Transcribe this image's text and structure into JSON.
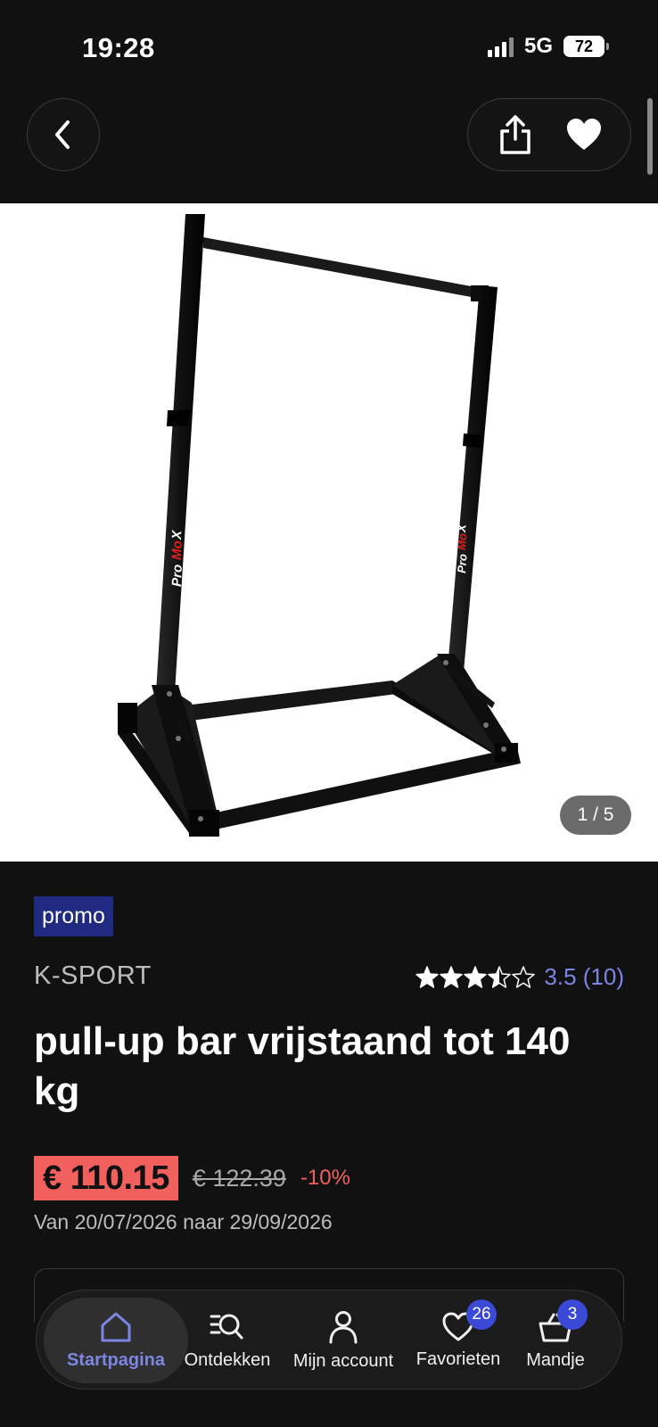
{
  "status_bar": {
    "time": "19:28",
    "network": "5G",
    "battery": "72"
  },
  "nav": {
    "back_icon": "chevron-left-icon",
    "share_icon": "share-icon",
    "favorite_icon": "heart-icon"
  },
  "gallery": {
    "counter": "1 / 5",
    "current": 1,
    "total": 5
  },
  "product": {
    "badge": "promo",
    "brand": "K-SPORT",
    "rating_value": 3.5,
    "rating_text": "3.5 (10)",
    "title": "pull-up bar vrijstaand tot 140 kg",
    "price_current": "€ 110.15",
    "price_old": "€ 122.39",
    "discount": "-10%",
    "validity": "Van 20/07/2026 naar 29/09/2026"
  },
  "tabbar": {
    "items": [
      {
        "label": "Startpagina",
        "icon": "home-icon",
        "active": true
      },
      {
        "label": "Ontdekken",
        "icon": "discover-search-icon",
        "active": false
      },
      {
        "label": "Mijn account",
        "icon": "person-icon",
        "active": false
      },
      {
        "label": "Favorieten",
        "icon": "heart-outline-icon",
        "active": false,
        "badge": "26"
      },
      {
        "label": "Mandje",
        "icon": "basket-icon",
        "active": false,
        "badge": "3"
      }
    ]
  },
  "colors": {
    "background": "#111111",
    "promo_badge": "#1f2a80",
    "price_highlight": "#f2605e",
    "accent": "#7b86e2",
    "tab_badge": "#3a49d6"
  }
}
